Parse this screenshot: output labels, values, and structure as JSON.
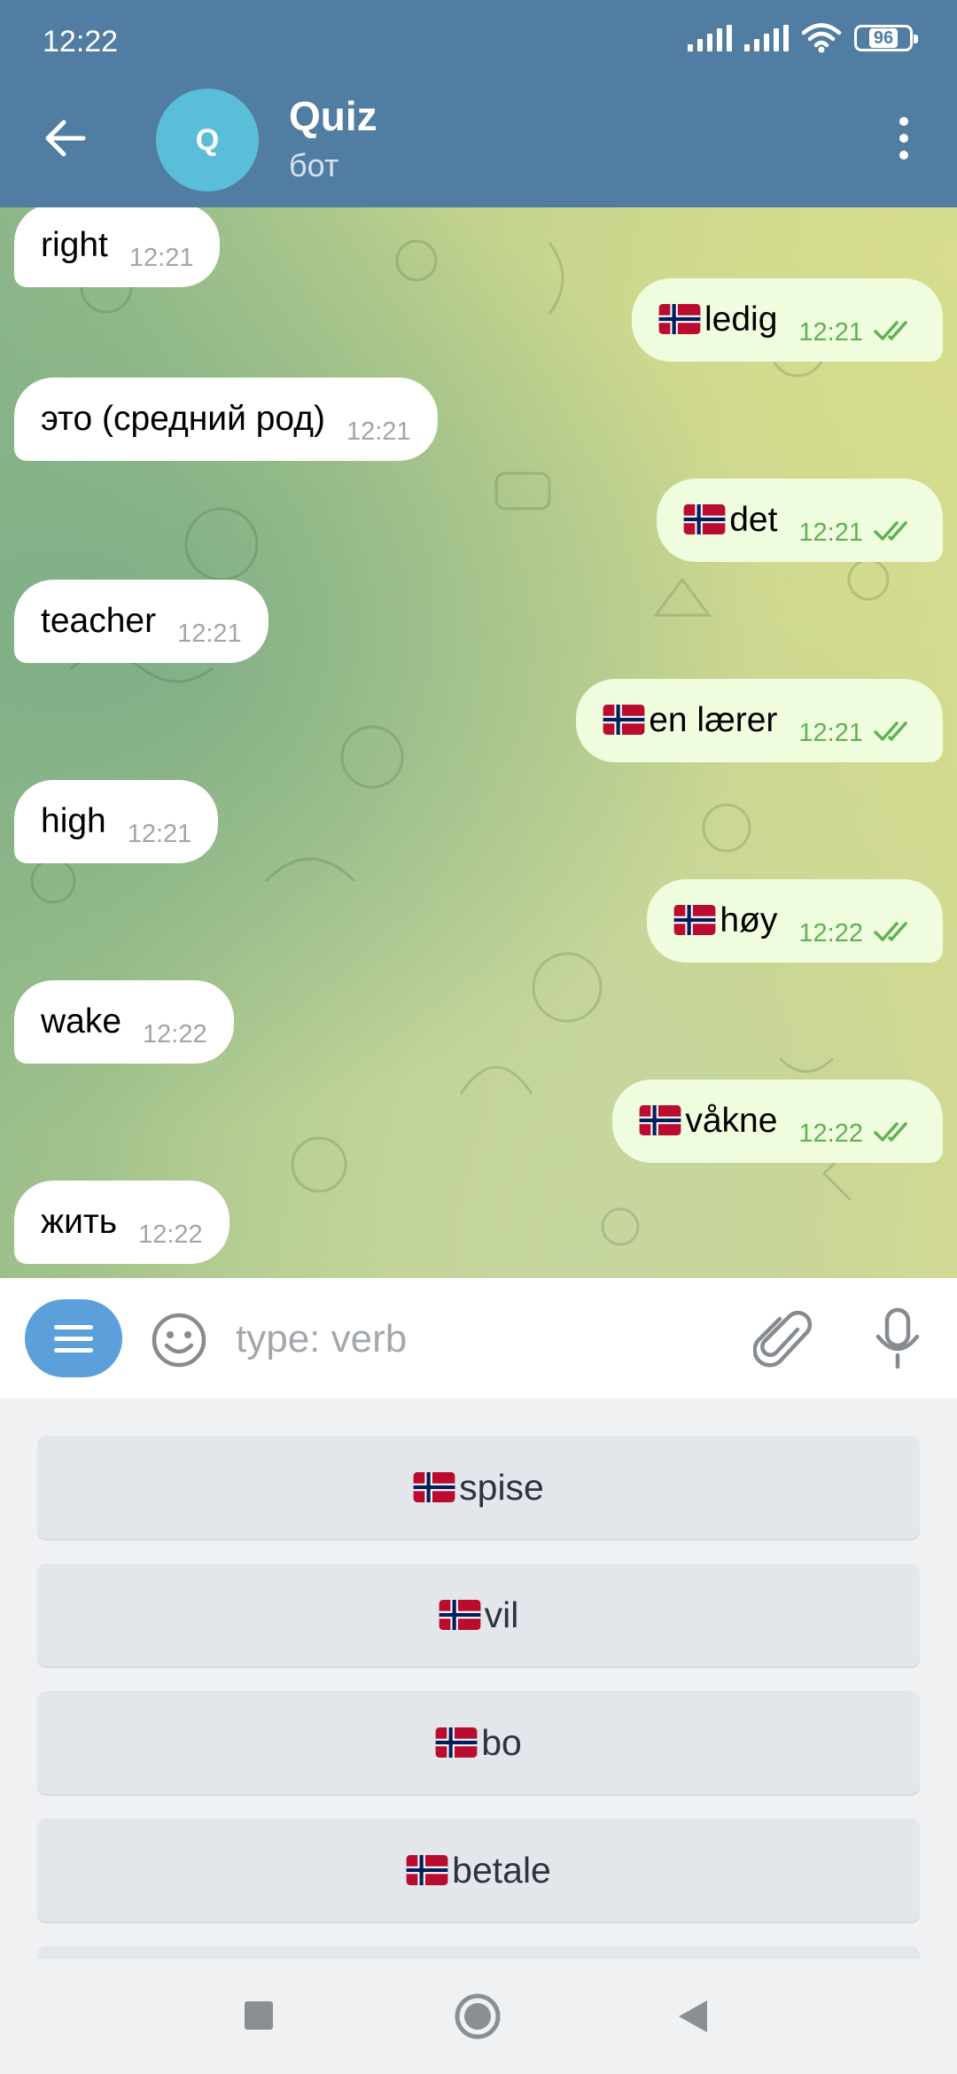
{
  "status_bar": {
    "time": "12:22",
    "battery": "96"
  },
  "header": {
    "avatar_letter": "Q",
    "title": "Quiz",
    "subtitle": "бот"
  },
  "messages": [
    {
      "dir": "in",
      "text": "right",
      "time": "12:21"
    },
    {
      "dir": "out",
      "text": "ledig",
      "flag": true,
      "time": "12:21",
      "read": true
    },
    {
      "dir": "in",
      "text": "это (средний род)",
      "time": "12:21"
    },
    {
      "dir": "out",
      "text": "det",
      "flag": true,
      "time": "12:21",
      "read": true
    },
    {
      "dir": "in",
      "text": "teacher",
      "time": "12:21"
    },
    {
      "dir": "out",
      "text": "en lærer",
      "flag": true,
      "time": "12:21",
      "read": true
    },
    {
      "dir": "in",
      "text": "high",
      "time": "12:21"
    },
    {
      "dir": "out",
      "text": "høy",
      "flag": true,
      "time": "12:22",
      "read": true
    },
    {
      "dir": "in",
      "text": "wake",
      "time": "12:22"
    },
    {
      "dir": "out",
      "text": "våkne",
      "flag": true,
      "time": "12:22",
      "read": true
    },
    {
      "dir": "in",
      "text": "жить",
      "time": "12:22"
    }
  ],
  "input": {
    "placeholder": "type: verb",
    "value": ""
  },
  "keyboard": {
    "buttons": [
      "spise",
      "vil",
      "bo",
      "betale"
    ],
    "flag": "norway-flag-icon"
  },
  "colors": {
    "header": "#517da2",
    "accent": "#5b9fdb",
    "outgoing_bubble": "#effdde",
    "read_check": "#5fb251"
  }
}
